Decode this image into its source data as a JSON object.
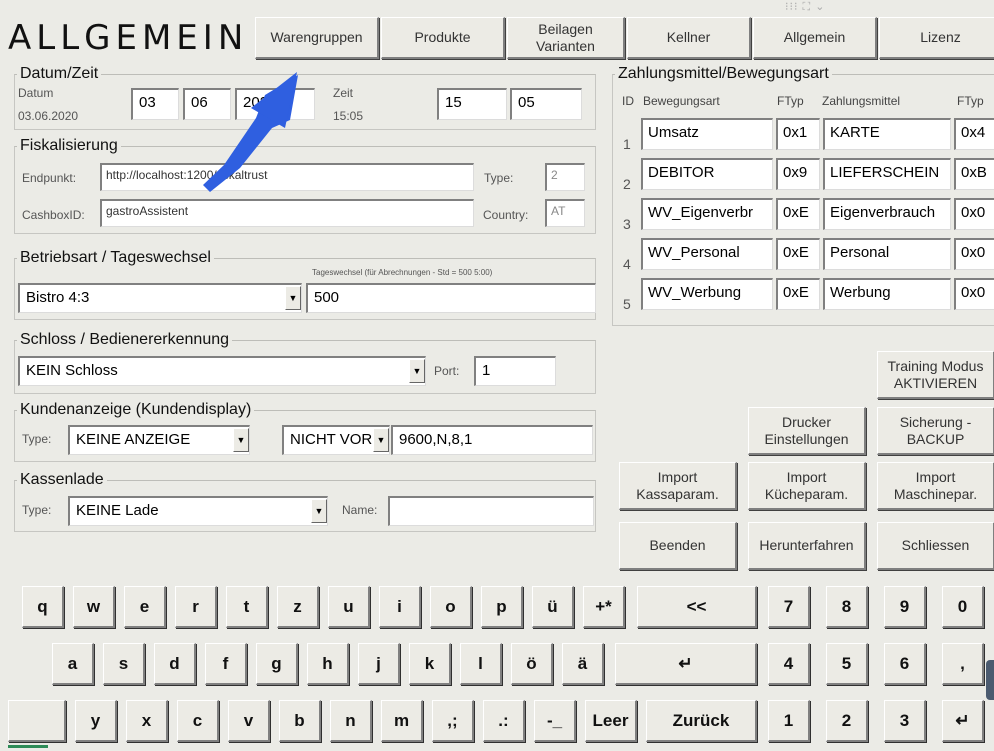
{
  "app": {
    "title": "ALLGEMEIN"
  },
  "tabs": [
    {
      "label": "Warengruppen"
    },
    {
      "label": "Produkte"
    },
    {
      "label": "Beilagen\nVarianten"
    },
    {
      "label": "Kellner"
    },
    {
      "label": "Allgemein"
    },
    {
      "label": "Lizenz"
    }
  ],
  "datetime": {
    "group": "Datum/Zeit",
    "date_label": "Datum",
    "date_value": "03.06.2020",
    "day": "03",
    "month": "06",
    "year": "2020",
    "time_label": "Zeit",
    "time_value": "15:05",
    "hour": "15",
    "minute": "05"
  },
  "fiscal": {
    "group": "Fiskalisierung",
    "endpoint_label": "Endpunkt:",
    "endpoint_value": "http://localhost:1200/fiskaltrust",
    "type_label": "Type:",
    "type_value": "2",
    "cashbox_label": "CashboxID:",
    "cashbox_value": "gastroAssistent",
    "country_label": "Country:",
    "country_value": "AT"
  },
  "operation": {
    "group": "Betriebsart / Tageswechsel",
    "hint": "Tageswechsel (für Abrechnungen - Std = 500 5:00)",
    "mode_value": "Bistro 4:3",
    "day_change_value": "500"
  },
  "lock": {
    "group": "Schloss / Bedienererkennung",
    "lock_value": "KEIN Schloss",
    "port_label": "Port:",
    "port_value": "1"
  },
  "display": {
    "group": "Kundenanzeige (Kundendisplay)",
    "type_label": "Type:",
    "type_value": "KEINE ANZEIGE",
    "port_value": "NICHT VOR",
    "settings_value": "9600,N,8,1"
  },
  "drawer": {
    "group": "Kassenlade",
    "type_label": "Type:",
    "type_value": "KEINE Lade",
    "name_label": "Name:",
    "name_value": ""
  },
  "payments": {
    "group": "Zahlungsmittel/Bewegungsart",
    "headers": [
      "ID",
      "Bewegungsart",
      "FTyp",
      "Zahlungsmittel",
      "FTyp"
    ],
    "rows": [
      {
        "id": "1",
        "movement": "Umsatz",
        "ftyp1": "0x1",
        "payment": "KARTE",
        "ftyp2": "0x4"
      },
      {
        "id": "2",
        "movement": "DEBITOR",
        "ftyp1": "0x9",
        "payment": "LIEFERSCHEIN",
        "ftyp2": "0xB"
      },
      {
        "id": "3",
        "movement": "WV_Eigenverbr",
        "ftyp1": "0xE",
        "payment": "Eigenverbrauch",
        "ftyp2": "0x0"
      },
      {
        "id": "4",
        "movement": "WV_Personal",
        "ftyp1": "0xE",
        "payment": "Personal",
        "ftyp2": "0x0"
      },
      {
        "id": "5",
        "movement": "WV_Werbung",
        "ftyp1": "0xE",
        "payment": "Werbung",
        "ftyp2": "0x0"
      }
    ]
  },
  "actions": {
    "training": "Training Modus\nAKTIVIEREN",
    "printer": "Drucker\nEinstellungen",
    "backup": "Sicherung -\nBACKUP",
    "import_kassa": "Import\nKassaparam.",
    "import_kueche": "Import\nKücheparam.",
    "import_maschine": "Import\nMaschinepar.",
    "quit": "Beenden",
    "shutdown": "Herunterfahren",
    "close": "Schliessen"
  },
  "keyboard": {
    "row1": [
      "q",
      "w",
      "e",
      "r",
      "t",
      "z",
      "u",
      "i",
      "o",
      "p",
      "ü",
      "+*"
    ],
    "row2": [
      "a",
      "s",
      "d",
      "f",
      "g",
      "h",
      "j",
      "k",
      "l",
      "ö",
      "ä"
    ],
    "row3": [
      "y",
      "x",
      "c",
      "v",
      "b",
      "n",
      "m",
      ",;",
      ".:",
      "-_"
    ],
    "backspace": "<<",
    "enter": "↵",
    "space": "Leer",
    "back": "Zurück",
    "numpad": [
      [
        "7",
        "8",
        "9",
        "0"
      ],
      [
        "4",
        "5",
        "6",
        ","
      ],
      [
        "1",
        "2",
        "3",
        "↵"
      ]
    ]
  },
  "top_icons": "⁝⁝⁝ ⛶ ⌄",
  "colors": {
    "background": "#ebebe6",
    "arrow": "#2f5fe0"
  }
}
